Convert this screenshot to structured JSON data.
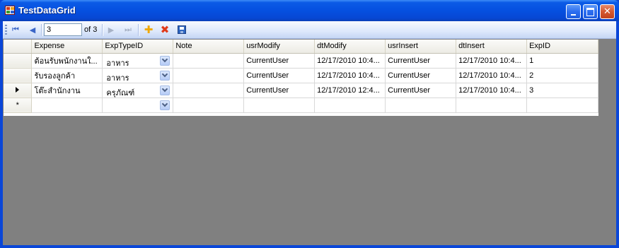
{
  "window": {
    "title": "TestDataGrid",
    "icon": "app-icon"
  },
  "navigator": {
    "position": "3",
    "count_label": "of 3",
    "icons": [
      "move-first-icon",
      "move-previous-icon",
      "move-next-icon",
      "move-last-icon",
      "add-new-icon",
      "delete-icon",
      "save-icon"
    ]
  },
  "grid": {
    "columns": [
      "Expense",
      "ExpTypeID",
      "Note",
      "usrModify",
      "dtModify",
      "usrInsert",
      "dtInsert",
      "ExpID"
    ],
    "rows": [
      {
        "marker": "",
        "Expense": "ต้อนรับพนักงานใ...",
        "ExpTypeID": "อาหาร",
        "Note": "",
        "usrModify": "CurrentUser",
        "dtModify": "12/17/2010 10:4...",
        "usrInsert": "CurrentUser",
        "dtInsert": "12/17/2010 10:4...",
        "ExpID": "1"
      },
      {
        "marker": "",
        "Expense": "รับรองลูกค้า",
        "ExpTypeID": "อาหาร",
        "Note": "",
        "usrModify": "CurrentUser",
        "dtModify": "12/17/2010 10:4...",
        "usrInsert": "CurrentUser",
        "dtInsert": "12/17/2010 10:4...",
        "ExpID": "2"
      },
      {
        "marker": "current",
        "Expense": "โต๊ะสำนักงาน",
        "ExpTypeID": "ครุภัณฑ์",
        "Note": "",
        "usrModify": "CurrentUser",
        "dtModify": "12/17/2010 12:4...",
        "usrInsert": "CurrentUser",
        "dtInsert": "12/17/2010 10:4...",
        "ExpID": "3"
      }
    ],
    "new_row_marker": "*"
  },
  "colors": {
    "title_bar": "#0550e0",
    "grid_background": "#808080",
    "toolstrip": "#dde8fb"
  }
}
